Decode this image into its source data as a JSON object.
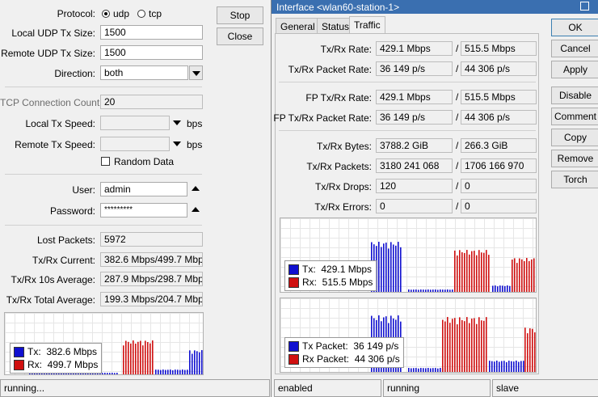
{
  "left": {
    "protocol_label": "Protocol:",
    "protocol_options": [
      "udp",
      "tcp"
    ],
    "protocol_selected": "udp",
    "local_udp_label": "Local UDP Tx Size:",
    "local_udp_value": "1500",
    "remote_udp_label": "Remote UDP Tx Size:",
    "remote_udp_value": "1500",
    "direction_label": "Direction:",
    "direction_value": "both",
    "tcp_count_label": "TCP Connection Count:",
    "tcp_count_value": "20",
    "local_tx_speed_label": "Local Tx Speed:",
    "remote_tx_speed_label": "Remote Tx Speed:",
    "bps": "bps",
    "random_data_label": "Random Data",
    "user_label": "User:",
    "user_value": "admin",
    "password_label": "Password:",
    "password_value": "*********",
    "lost_packets_label": "Lost Packets:",
    "lost_packets_value": "5972",
    "txrx_current_label": "Tx/Rx Current:",
    "txrx_current_value": "382.6 Mbps/499.7 Mbps",
    "txrx_10s_label": "Tx/Rx 10s Average:",
    "txrx_10s_value": "287.9 Mbps/298.7 Mbps",
    "txrx_total_label": "Tx/Rx Total Average:",
    "txrx_total_value": "199.3 Mbps/204.7 Mbps",
    "graph_legend": {
      "tx_label": "Tx:",
      "tx_value": "382.6 Mbps",
      "rx_label": "Rx:",
      "rx_value": "499.7 Mbps"
    },
    "status_text": "running...",
    "buttons": {
      "stop": "Stop",
      "close": "Close"
    }
  },
  "window": {
    "title": "Interface <wlan60-station-1>",
    "tabs": [
      "General",
      "Status",
      "Traffic"
    ],
    "active_tab": "Traffic",
    "fields": {
      "txrx_rate_label": "Tx/Rx Rate:",
      "txrx_rate_tx": "429.1 Mbps",
      "txrx_rate_rx": "515.5 Mbps",
      "txrx_pkt_rate_label": "Tx/Rx Packet Rate:",
      "txrx_pkt_rate_tx": "36 149 p/s",
      "txrx_pkt_rate_rx": "44 306 p/s",
      "fp_rate_label": "FP Tx/Rx Rate:",
      "fp_rate_tx": "429.1 Mbps",
      "fp_rate_rx": "515.5 Mbps",
      "fp_pkt_rate_label": "FP Tx/Rx Packet Rate:",
      "fp_pkt_rate_tx": "36 149 p/s",
      "fp_pkt_rate_rx": "44 306 p/s",
      "bytes_label": "Tx/Rx Bytes:",
      "bytes_tx": "3788.2 GiB",
      "bytes_rx": "266.3 GiB",
      "packets_label": "Tx/Rx Packets:",
      "packets_tx": "3180 241 068",
      "packets_rx": "1706 166 970",
      "drops_label": "Tx/Rx Drops:",
      "drops_tx": "120",
      "drops_rx": "0",
      "errors_label": "Tx/Rx Errors:",
      "errors_tx": "0",
      "errors_rx": "0",
      "slash": "/"
    },
    "graph1_legend": {
      "tx_label": "Tx:",
      "tx_value": "429.1 Mbps",
      "rx_label": "Rx:",
      "rx_value": "515.5 Mbps"
    },
    "graph2_legend": {
      "tx_label": "Tx Packet:",
      "tx_value": "36 149 p/s",
      "rx_label": "Rx Packet:",
      "rx_value": "44 306 p/s"
    },
    "buttons": {
      "ok": "OK",
      "cancel": "Cancel",
      "apply": "Apply",
      "disable": "Disable",
      "comment": "Comment",
      "copy": "Copy",
      "remove": "Remove",
      "torch": "Torch"
    },
    "status": {
      "enabled": "enabled",
      "running": "running",
      "slave": "slave"
    }
  },
  "colors": {
    "tx": "#1010d0",
    "rx": "#d01010",
    "titlebar": "#3a6fb0"
  }
}
